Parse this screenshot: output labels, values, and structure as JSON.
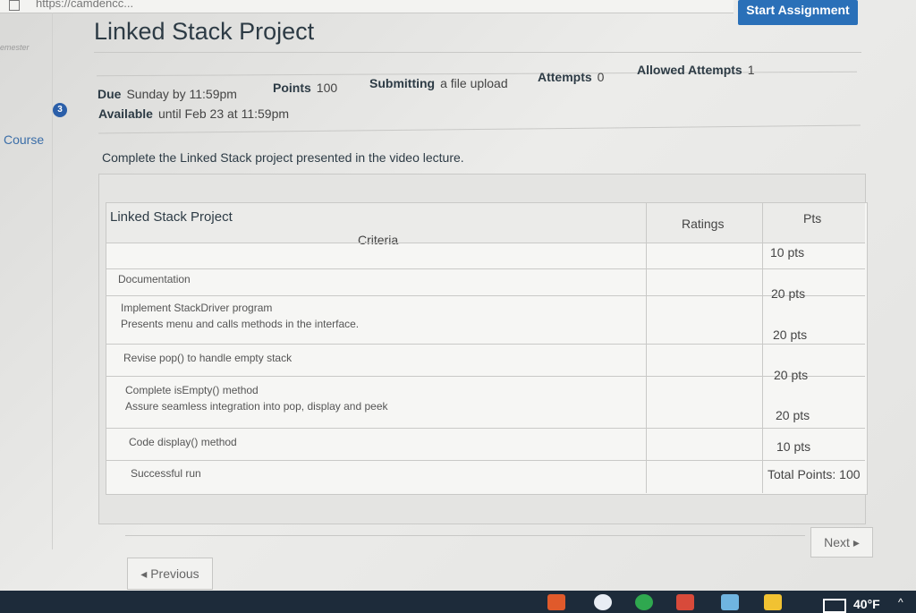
{
  "browser": {
    "url_text": "https://camdencc..."
  },
  "left_rail": {
    "semester_text": "emester",
    "badge_count": "3",
    "course_link": "Course"
  },
  "assignment": {
    "title": "Linked Stack Project",
    "start_button": "Start Assignment",
    "due_label": "Due",
    "due_value": "Sunday by 11:59pm",
    "points_label": "Points",
    "points_value": "100",
    "submitting_label": "Submitting",
    "submitting_value": "a file upload",
    "attempts_label": "Attempts",
    "attempts_value": "0",
    "allowed_label": "Allowed Attempts",
    "allowed_value": "1",
    "available_label": "Available",
    "available_value": "until Feb 23 at 11:59pm",
    "description": "Complete the Linked Stack project presented in the video lecture."
  },
  "rubric": {
    "title": "Linked Stack Project",
    "headers": {
      "criteria": "Criteria",
      "ratings": "Ratings",
      "pts": "Pts"
    },
    "rows": [
      {
        "criterion": "Documentation",
        "description": "",
        "pts": "10 pts"
      },
      {
        "criterion": "Implement StackDriver program",
        "description": "Presents menu and calls methods in the interface.",
        "pts": "20 pts"
      },
      {
        "criterion": "Revise pop() to handle empty stack",
        "description": "",
        "pts": "20 pts"
      },
      {
        "criterion": "Complete isEmpty() method",
        "description": "Assure seamless integration into pop, display and peek",
        "pts": "20 pts"
      },
      {
        "criterion": "Code display() method",
        "description": "",
        "pts": "20 pts"
      },
      {
        "criterion": "Successful run",
        "description": "",
        "pts": "10 pts"
      }
    ],
    "total": "Total Points: 100"
  },
  "navigation": {
    "previous": "◂ Previous",
    "next": "Next ▸"
  },
  "taskbar": {
    "weather": "40°F",
    "caret": "^"
  }
}
